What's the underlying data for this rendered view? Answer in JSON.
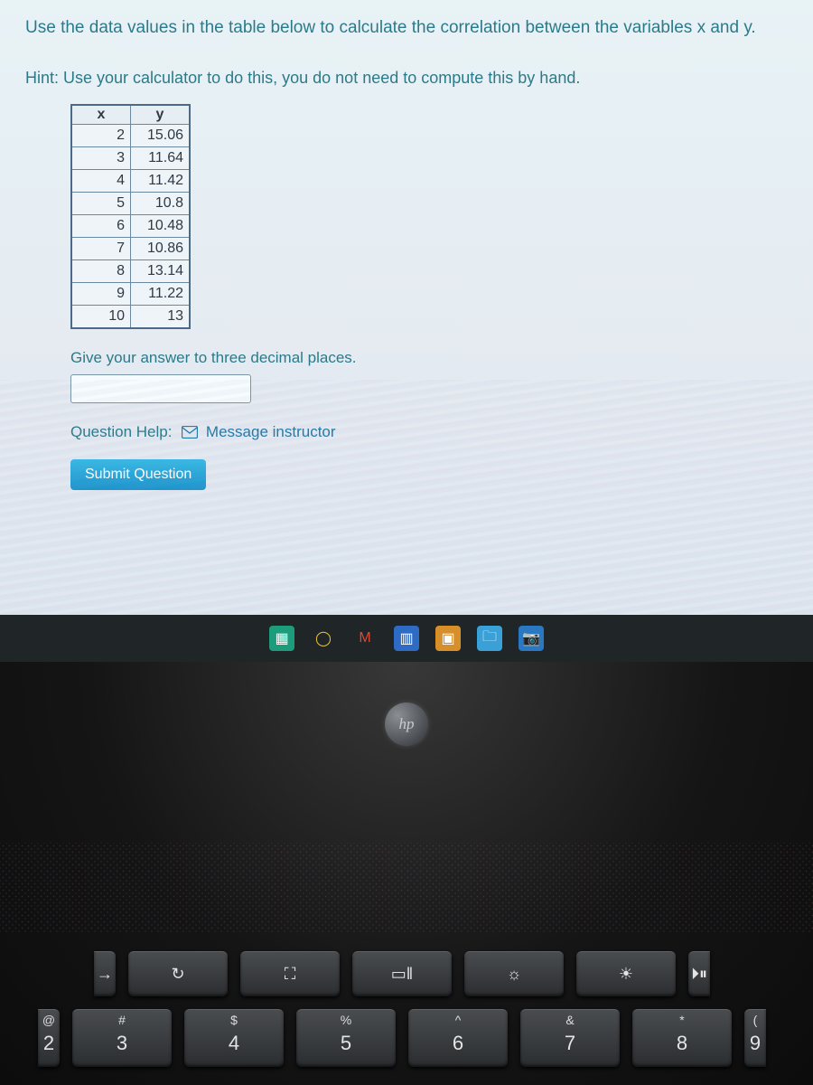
{
  "question": {
    "prompt": "Use the data values in the table below to calculate the correlation between the variables x and y.",
    "hint": "Hint: Use your calculator to do this, you do not need to compute this by hand.",
    "instruction": "Give your answer to three decimal places.",
    "help_label": "Question Help:",
    "help_link": "Message instructor",
    "submit_label": "Submit Question",
    "answer_value": ""
  },
  "chart_data": {
    "type": "table",
    "columns": [
      "x",
      "y"
    ],
    "rows": [
      {
        "x": "2",
        "y": "15.06"
      },
      {
        "x": "3",
        "y": "11.64"
      },
      {
        "x": "4",
        "y": "11.42"
      },
      {
        "x": "5",
        "y": "10.8"
      },
      {
        "x": "6",
        "y": "10.48"
      },
      {
        "x": "7",
        "y": "10.86"
      },
      {
        "x": "8",
        "y": "13.14"
      },
      {
        "x": "9",
        "y": "11.22"
      },
      {
        "x": "10",
        "y": "13"
      }
    ]
  },
  "taskbar": {
    "items": [
      {
        "name": "spreadsheet-icon",
        "glyph": "▦",
        "bg": "#1c9c7a",
        "fg": "#ffffff"
      },
      {
        "name": "chrome-icon",
        "glyph": "◯",
        "bg": "transparent",
        "fg": "#eec232"
      },
      {
        "name": "gmail-icon",
        "glyph": "M",
        "bg": "transparent",
        "fg": "#e24634"
      },
      {
        "name": "word-icon",
        "glyph": "▥",
        "bg": "#2e6bc5",
        "fg": "#ffffff"
      },
      {
        "name": "music-icon",
        "glyph": "▣",
        "bg": "#d78f2a",
        "fg": "#ffffff"
      },
      {
        "name": "folder-icon",
        "glyph": "🗀",
        "bg": "#3aa0d8",
        "fg": "#ffffff"
      },
      {
        "name": "camera-icon",
        "glyph": "📷",
        "bg": "#2a78c2",
        "fg": "#ffffff"
      }
    ]
  },
  "laptop": {
    "brand": "hp",
    "fn_row": [
      {
        "name": "key-tab-arrow",
        "sym": "→"
      },
      {
        "name": "key-refresh",
        "sym": "↻"
      },
      {
        "name": "key-fullscreen",
        "sym": "⛶"
      },
      {
        "name": "key-overview",
        "sym": "▭‖"
      },
      {
        "name": "key-bright-dn",
        "sym": "☼"
      },
      {
        "name": "key-bright-up",
        "sym": "☀"
      },
      {
        "name": "key-play",
        "sym": "⏵⏸"
      }
    ],
    "num_row": [
      {
        "name": "key-2",
        "top": "@",
        "main": "2"
      },
      {
        "name": "key-3",
        "top": "#",
        "main": "3"
      },
      {
        "name": "key-4",
        "top": "$",
        "main": "4"
      },
      {
        "name": "key-5",
        "top": "%",
        "main": "5"
      },
      {
        "name": "key-6",
        "top": "^",
        "main": "6"
      },
      {
        "name": "key-7",
        "top": "&",
        "main": "7"
      },
      {
        "name": "key-8",
        "top": "*",
        "main": "8"
      },
      {
        "name": "key-9",
        "top": "(",
        "main": "9"
      }
    ]
  }
}
